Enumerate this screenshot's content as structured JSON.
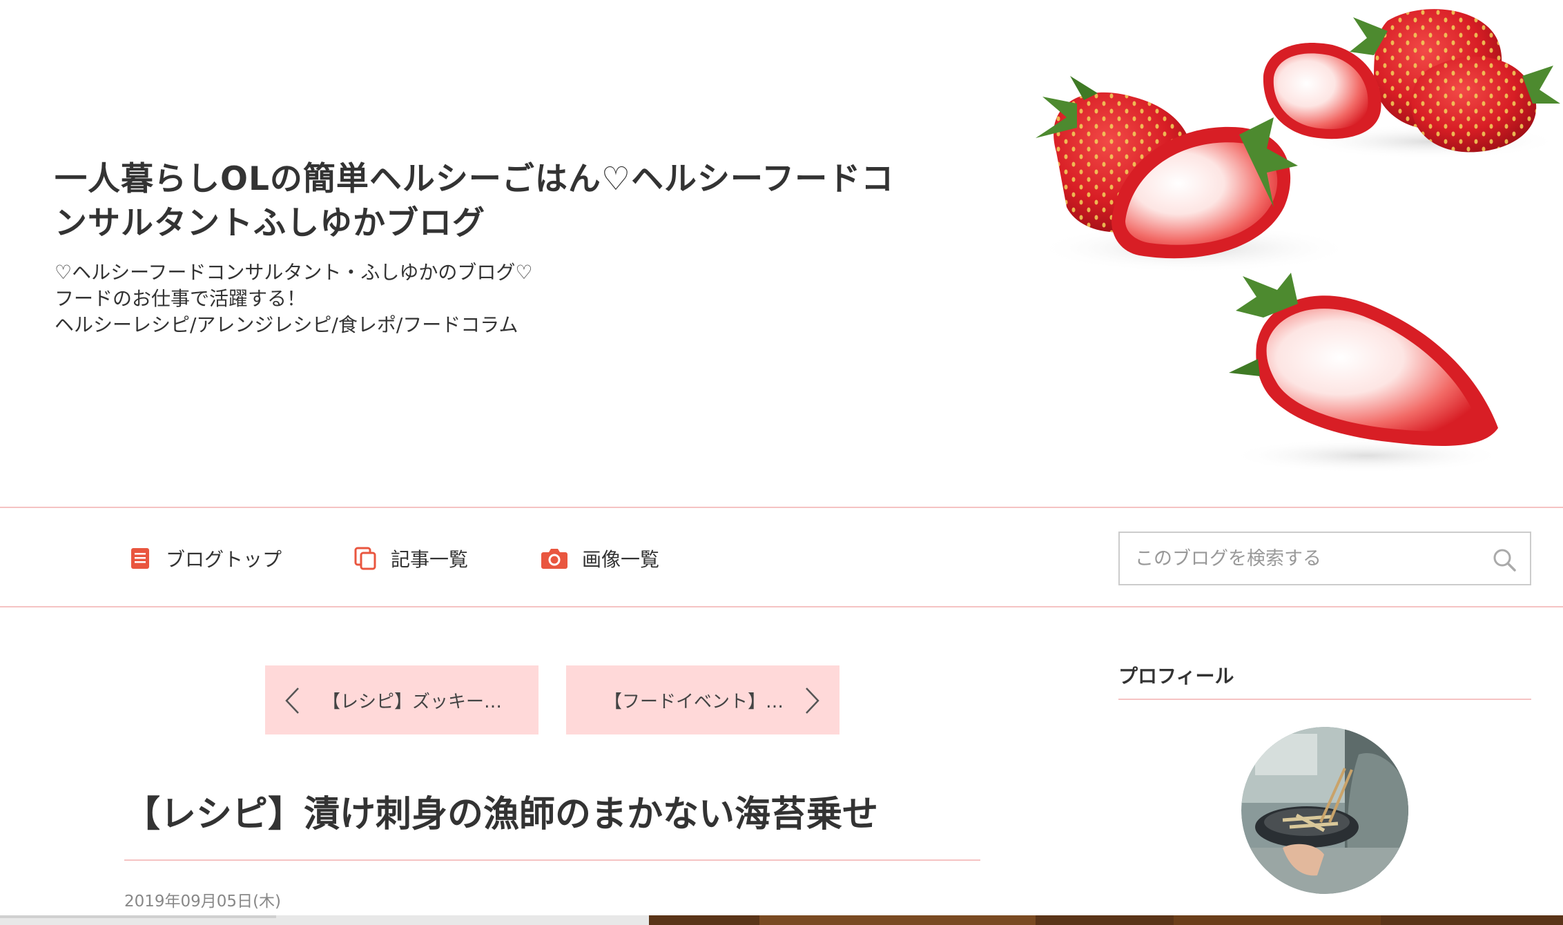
{
  "header": {
    "title_line1": "一人暮らしOLの簡単ヘルシーごはん♡ヘルシーフードコ",
    "title_line2": "ンサルタントふしゆかブログ",
    "description": [
      "♡ヘルシーフードコンサルタント・ふしゆかのブログ♡",
      "フードのお仕事で活躍する！",
      "ヘルシーレシピ/アレンジレシピ/食レポ/フードコラム"
    ]
  },
  "nav": {
    "items": [
      {
        "label": "ブログトップ",
        "icon": "document-icon"
      },
      {
        "label": "記事一覧",
        "icon": "copy-icon"
      },
      {
        "label": "画像一覧",
        "icon": "camera-icon"
      }
    ],
    "search_placeholder": "このブログを検索する"
  },
  "pager": {
    "prev_label": "【レシピ】ズッキー…",
    "next_label": "【フードイベント】…"
  },
  "article": {
    "title": "【レシピ】漬け刺身の漁師のまかない海苔乗せ",
    "date": "2019年09月05日(木)"
  },
  "sidebar": {
    "heading": "プロフィール"
  },
  "colors": {
    "accent": "#e9563f",
    "rule_pink": "#f5c3c3",
    "button_pink": "#ffd9d9"
  }
}
